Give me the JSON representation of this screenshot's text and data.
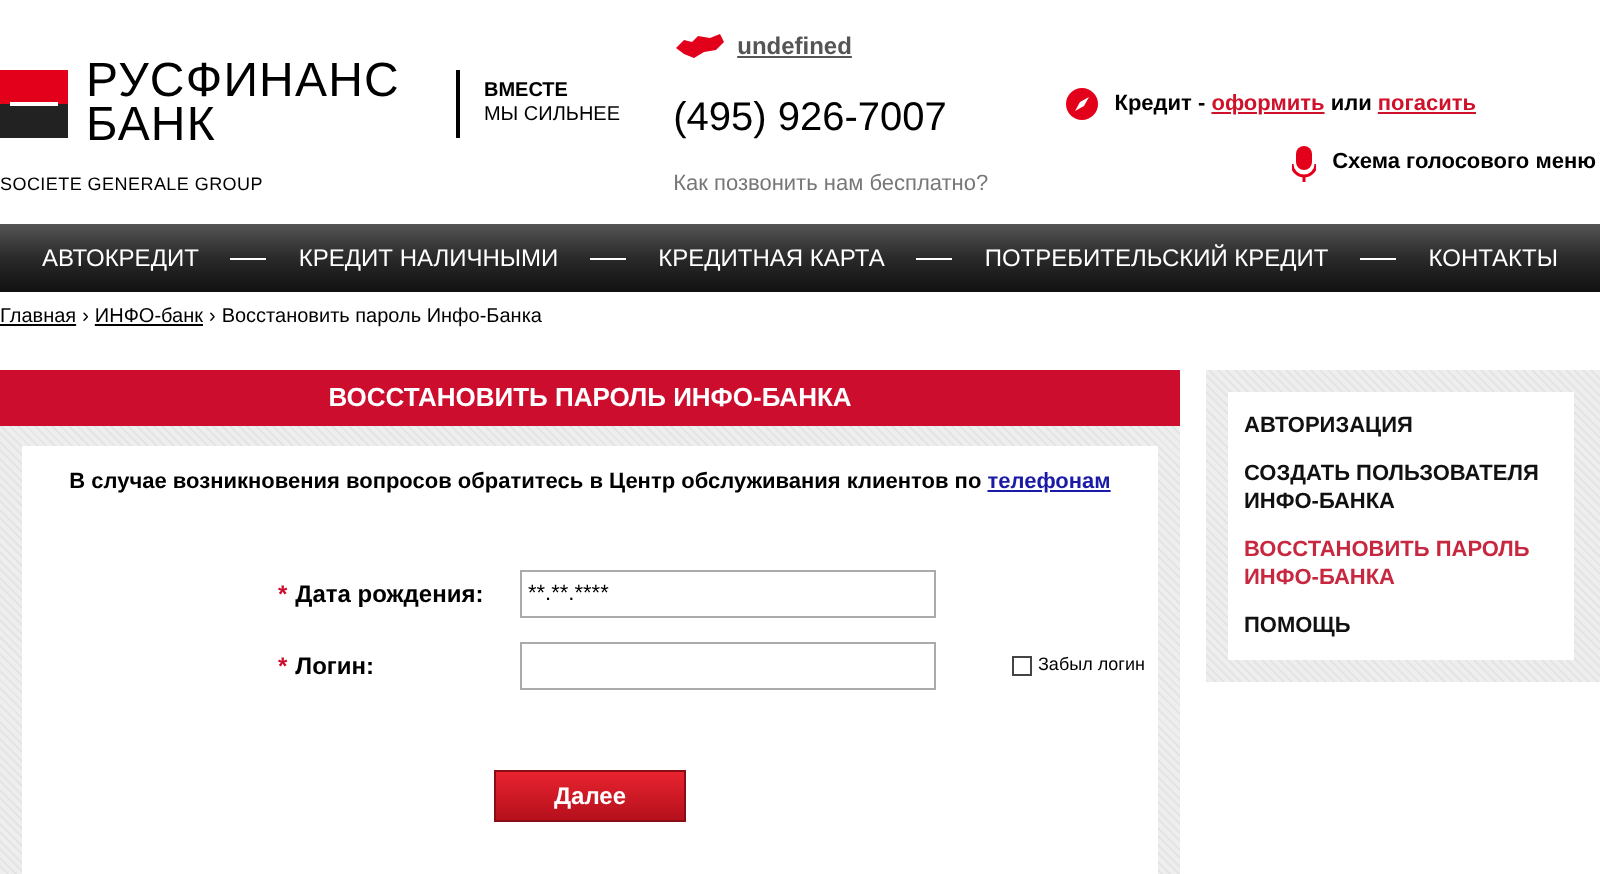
{
  "header": {
    "logo_line1": "РУСФИНАНС",
    "logo_line2": "БАНК",
    "logo_group": "SOCIETE GENERALE GROUP",
    "slogan_line1": "ВМЕСТЕ",
    "slogan_line2": "МЫ СИЛЬНЕЕ",
    "region": "undefined",
    "phone": "(495) 926-7007",
    "free_call": "Как позвонить нам бесплатно?",
    "credit_label": "Кредит -",
    "credit_apply": "оформить",
    "credit_or": "или",
    "credit_repay": "погасить",
    "voice_menu": "Схема голосового меню"
  },
  "nav": [
    {
      "label": "АВТОКРЕДИТ"
    },
    {
      "label": "КРЕДИТ НАЛИЧНЫМИ"
    },
    {
      "label": "КРЕДИТНАЯ КАРТА"
    },
    {
      "label": "ПОТРЕБИТЕЛЬСКИЙ КРЕДИТ"
    },
    {
      "label": "КОНТАКТЫ"
    }
  ],
  "breadcrumb": {
    "links": [
      "Главная",
      "ИНФО-банк"
    ],
    "separator": "›",
    "current": "Восстановить пароль Инфо-Банка"
  },
  "form": {
    "title": "ВОССТАНОВИТЬ ПАРОЛЬ ИНФО-БАНКА",
    "notice": "В случае возникновения вопросов обратитесь в Центр обслуживания клиентов по",
    "notice_link": "телефонам",
    "fields": [
      {
        "required_mark": "*",
        "label": "Дата рождения:",
        "value": "**.**.****"
      },
      {
        "required_mark": "*",
        "label": "Логин:",
        "checkbox": {
          "label": "Забыл логин",
          "checked": false
        }
      }
    ],
    "submit": "Далее"
  },
  "sidebar": {
    "items": [
      {
        "label": "АВТОРИЗАЦИЯ",
        "selected": false
      },
      {
        "label": "СОЗДАТЬ ПОЛЬЗОВАТЕЛЯ ИНФО-БАНКА",
        "selected": false
      },
      {
        "label": "ВОССТАНОВИТЬ ПАРОЛЬ ИНФО-БАНКА",
        "selected": true
      },
      {
        "label": "ПОМОЩЬ",
        "selected": false
      }
    ]
  }
}
